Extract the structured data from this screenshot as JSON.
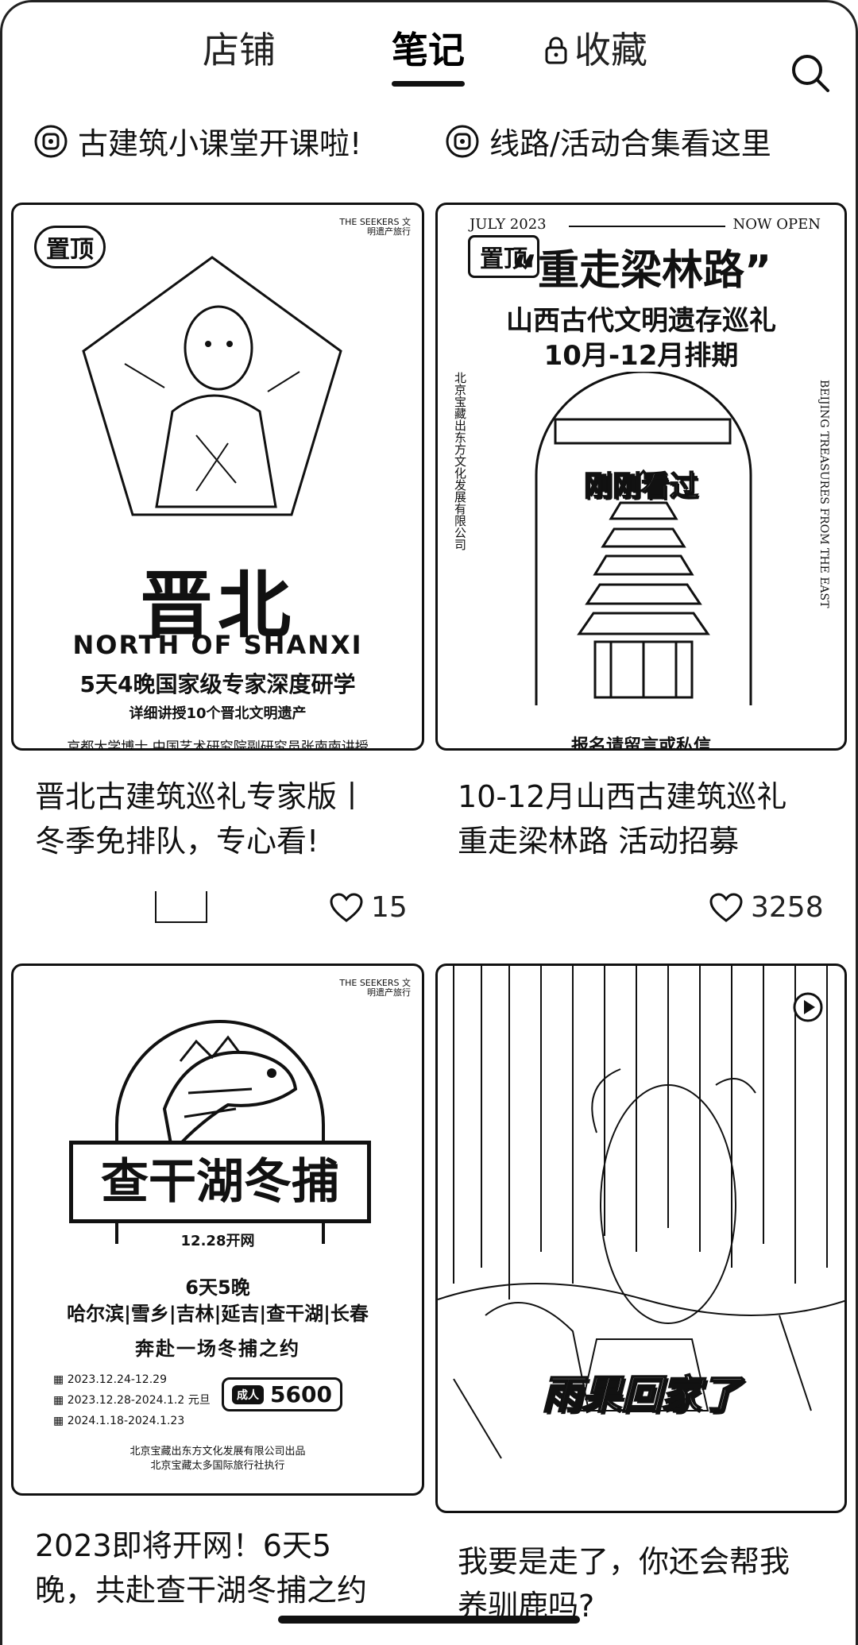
{
  "tabs": {
    "shop": "店铺",
    "notes": "笔记",
    "favorites": "收藏",
    "search_icon": "search-icon",
    "lock_icon": "lock-icon"
  },
  "quick_links": [
    {
      "label": "古建筑小课堂开课啦!",
      "icon": "channel-icon"
    },
    {
      "label": "线路/活动合集看这里",
      "icon": "channel-icon"
    }
  ],
  "notes": [
    {
      "title_line1": "晋北古建筑巡礼专家版丨",
      "title_line2": "冬季免排队，专心看!",
      "likes": "15",
      "pinned": "置顶",
      "cover": {
        "logo": "THE SEEKERS 文明遗产旅行",
        "big_title": "晋北",
        "english": "NORTH OF SHANXI",
        "subtitle": "5天4晚国家级专家深度研学",
        "detail": "详细讲授10个晋北文明遗产",
        "lecturer": "京都大学博士  中国艺术研究院副研究员张南南讲授"
      }
    },
    {
      "title_line1": "10-12月山西古建筑巡礼",
      "title_line2": "重走梁林路 活动招募",
      "likes": "3258",
      "pinned": "置顶",
      "cover": {
        "date": "JULY 2023",
        "now_open": "NOW OPEN",
        "headline": "“重走梁林路”",
        "line2": "山西古代文明遗存巡礼",
        "line3": "10月-12月排期",
        "side_left": "北京宝藏出东方文化发展有限公司",
        "side_right": "BEIJING TREASURES FROM THE EAST",
        "seen_label": "刚刚看过",
        "footer": "报名请留言或私信"
      }
    },
    {
      "title_line1": "2023即将开网！6天5",
      "title_line2": "晚，共赴查干湖冬捕之约",
      "cover": {
        "logo": "THE SEEKERS 文明遗产旅行",
        "banner": "查干湖冬捕",
        "net_date": "12.28开网",
        "days": "6天5晚",
        "cities": "哈尔滨|雪乡|吉林|延吉|查干湖|长春",
        "tagline": "奔赴一场冬捕之约",
        "dates": [
          "2023.12.24-12.29",
          "2023.12.28-2024.1.2  元旦",
          "2024.1.18-2024.1.23"
        ],
        "price_tag": "成人",
        "price": "5600",
        "org1": "北京宝藏出东方文化发展有限公司出品",
        "org2": "北京宝藏太多国际旅行社执行"
      }
    },
    {
      "title_line1": "我要是走了，你还会帮我",
      "title_line2": "养驯鹿吗?",
      "cover": {
        "overlay": "雨果回家了",
        "play_icon": "play-icon"
      }
    }
  ]
}
